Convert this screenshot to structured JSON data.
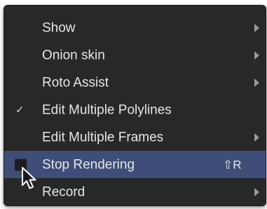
{
  "menu": {
    "items": [
      {
        "label": "Show",
        "has_submenu": true,
        "checked": false,
        "highlighted": false,
        "shortcut": ""
      },
      {
        "label": "Onion skin",
        "has_submenu": true,
        "checked": false,
        "highlighted": false,
        "shortcut": ""
      },
      {
        "label": "Roto Assist",
        "has_submenu": true,
        "checked": false,
        "highlighted": false,
        "shortcut": ""
      },
      {
        "label": "Edit Multiple Polylines",
        "has_submenu": false,
        "checked": true,
        "highlighted": false,
        "shortcut": ""
      },
      {
        "label": "Edit Multiple Frames",
        "has_submenu": true,
        "checked": false,
        "highlighted": false,
        "shortcut": ""
      },
      {
        "label": "Stop Rendering",
        "has_submenu": false,
        "checked": false,
        "highlighted": true,
        "shortcut": "⇧R"
      },
      {
        "label": "Record",
        "has_submenu": true,
        "checked": false,
        "highlighted": false,
        "shortcut": ""
      }
    ],
    "check_glyph": "✓",
    "icons": {
      "submenu": "chevron-right-icon",
      "check": "checkmark-icon",
      "cursor": "mouse-pointer-icon"
    },
    "colors": {
      "background": "#282828",
      "highlight": "#3e4e78",
      "text": "#e6e6e6",
      "arrow": "#9a9a9a"
    }
  }
}
